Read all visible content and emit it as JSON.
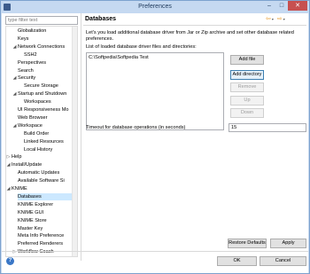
{
  "window": {
    "title": "Preferences"
  },
  "filter": {
    "placeholder": "type filter text"
  },
  "tree": [
    {
      "label": "Globalization",
      "depth": 2,
      "expander": ""
    },
    {
      "label": "Keys",
      "depth": 2,
      "expander": ""
    },
    {
      "label": "Network Connections",
      "depth": 2,
      "expander": "open"
    },
    {
      "label": "SSH2",
      "depth": 3,
      "expander": ""
    },
    {
      "label": "Perspectives",
      "depth": 2,
      "expander": ""
    },
    {
      "label": "Search",
      "depth": 2,
      "expander": ""
    },
    {
      "label": "Security",
      "depth": 2,
      "expander": "open"
    },
    {
      "label": "Secure Storage",
      "depth": 3,
      "expander": ""
    },
    {
      "label": "Startup and Shutdown",
      "depth": 2,
      "expander": "open"
    },
    {
      "label": "Workspaces",
      "depth": 3,
      "expander": ""
    },
    {
      "label": "UI Responsiveness Mo",
      "depth": 2,
      "expander": ""
    },
    {
      "label": "Web Browser",
      "depth": 2,
      "expander": ""
    },
    {
      "label": "Workspace",
      "depth": 2,
      "expander": "open"
    },
    {
      "label": "Build Order",
      "depth": 3,
      "expander": ""
    },
    {
      "label": "Linked Resources",
      "depth": 3,
      "expander": ""
    },
    {
      "label": "Local History",
      "depth": 3,
      "expander": ""
    },
    {
      "label": "Help",
      "depth": 1,
      "expander": "closed"
    },
    {
      "label": "Install/Update",
      "depth": 1,
      "expander": "open"
    },
    {
      "label": "Automatic Updates",
      "depth": 2,
      "expander": ""
    },
    {
      "label": "Available Software Si",
      "depth": 2,
      "expander": ""
    },
    {
      "label": "KNIME",
      "depth": 1,
      "expander": "open"
    },
    {
      "label": "Databases",
      "depth": 2,
      "expander": "",
      "selected": true
    },
    {
      "label": "KNIME Explorer",
      "depth": 2,
      "expander": ""
    },
    {
      "label": "KNIME GUI",
      "depth": 2,
      "expander": ""
    },
    {
      "label": "KNIME Store",
      "depth": 2,
      "expander": ""
    },
    {
      "label": "Master Key",
      "depth": 2,
      "expander": ""
    },
    {
      "label": "Meta Info Preference",
      "depth": 2,
      "expander": ""
    },
    {
      "label": "Preferred Renderers",
      "depth": 2,
      "expander": ""
    },
    {
      "label": "Workflow Coach",
      "depth": 2,
      "expander": "closed"
    }
  ],
  "page": {
    "title": "Databases",
    "description": "Let's you load additional database driver from Jar or Zip archive and set other database related preferences.",
    "list_label": "List of loaded database driver files and directories:",
    "drivers": [
      "C:\\Softpedia\\Softpedia Test"
    ],
    "timeout_label": "Timeout for database operations (in seconds)",
    "timeout_value": "15"
  },
  "buttons": {
    "add_file": "Add file",
    "add_directory": "Add directory",
    "remove": "Remove",
    "up": "Up",
    "down": "Down",
    "restore_defaults": "Restore Defaults",
    "apply": "Apply",
    "ok": "OK",
    "cancel": "Cancel"
  },
  "icons": {
    "nav_back": "back-arrow-icon",
    "nav_forward": "forward-arrow-icon",
    "help": "help-icon"
  }
}
